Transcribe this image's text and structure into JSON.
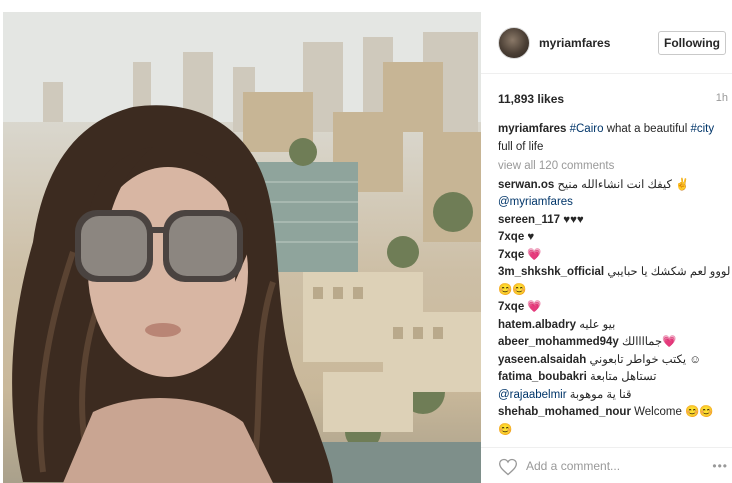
{
  "post": {
    "author": "myriamfares",
    "follow_label": "Following",
    "likes": "11,893 likes",
    "time_ago": "1h",
    "caption": {
      "username": "myriamfares",
      "hashtag1": "#Cairo",
      "text1": " what a beautiful ",
      "hashtag2": "#city",
      "text2": " full of life"
    },
    "view_all": "view all 120 comments",
    "comments": [
      {
        "username": "serwan.os",
        "text": " كيفك انت انشاءالله منيح ✌"
      },
      {
        "mention": "@myriamfares"
      },
      {
        "username": "sereen_117",
        "text": " ♥♥♥"
      },
      {
        "username": "7xqe",
        "text": " ♥"
      },
      {
        "username": "7xqe",
        "text": " 💗"
      },
      {
        "username": "3m_shkshk_official",
        "text": " فولووو لعم شكشك يا حبايبي"
      },
      {
        "text": "😊😊"
      },
      {
        "username": "7xqe",
        "text": " 💗"
      },
      {
        "username": "hatem.albadry",
        "text": " بيو عليه"
      },
      {
        "username": "abeer_mohammed94y",
        "text": " جماااالك💗"
      },
      {
        "username": "yaseen.alsaidah",
        "text": " يكتب خواطر تابعوني ☺"
      },
      {
        "username": "fatima_boubakri",
        "text": " تستاهل متابعة"
      },
      {
        "mention": "@rajaabelmir",
        "text": " قنا ية موهوبة"
      },
      {
        "username": "shehab_mohamed_nour",
        "text": " Welcome 😊😊"
      },
      {
        "text": "😊"
      }
    ],
    "add_comment_placeholder": "Add a comment...",
    "more_label": "•••"
  },
  "icons": {
    "like": "heart-icon",
    "more": "more-options-icon"
  },
  "colors": {
    "hashtag": "#003569",
    "muted": "#999999",
    "border": "#efefef"
  }
}
